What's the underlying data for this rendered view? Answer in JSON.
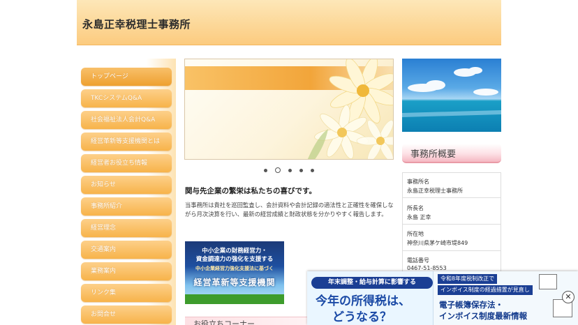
{
  "header": {
    "site_title": "永島正幸税理士事務所"
  },
  "sidebar": {
    "items": [
      {
        "label": "トップページ"
      },
      {
        "label": "TKCシステムQ&A"
      },
      {
        "label": "社会福祉法人会計Q&A"
      },
      {
        "label": "経営革新等支援機関とは"
      },
      {
        "label": "経営者お役立ち情報"
      },
      {
        "label": "お知らせ"
      },
      {
        "label": "事務所紹介"
      },
      {
        "label": "経営理念"
      },
      {
        "label": "交通案内"
      },
      {
        "label": "業務案内"
      },
      {
        "label": "リンク集"
      },
      {
        "label": "お問合せ"
      }
    ]
  },
  "main": {
    "lead": "関与先企業の繁栄は私たちの喜びです。",
    "body": "当事務所は貴社を巡回監査し、会計資料や会計記録の適法性と正確性を確保しながら月次決算を行い、最新の経営成績と財政状態を分かりやすく報告します。",
    "banner": {
      "line1": "中小企業の財務経営力・",
      "line2": "資金調達力の強化を支援する",
      "line3": "中小企業経営力強化支援法に基づく",
      "line4": "経営革新等支援機関"
    },
    "subhead": "お役立ちコーナー"
  },
  "right": {
    "about_heading": "事務所概要",
    "info": [
      {
        "label": "事務所名",
        "value": "永島正幸税理士事務所"
      },
      {
        "label": "所長名",
        "value": "永島 正幸"
      },
      {
        "label": "所在地",
        "value": "神奈川県茅ケ崎市堤849"
      },
      {
        "label": "電話番号",
        "value": "0467-51-8553"
      }
    ]
  },
  "ad": {
    "left_pill": "年末調整・給与計算に影響する",
    "left_big1": "今年の所得税は、",
    "left_big2": "どうなる？",
    "right_tag1": "令和8年度税制改正で",
    "right_tag2": "インボイス制度の経過措置が見直し",
    "right_line1": "電子帳簿保存法・",
    "right_line2": "インボイス制度最新情報",
    "close": "✕"
  }
}
